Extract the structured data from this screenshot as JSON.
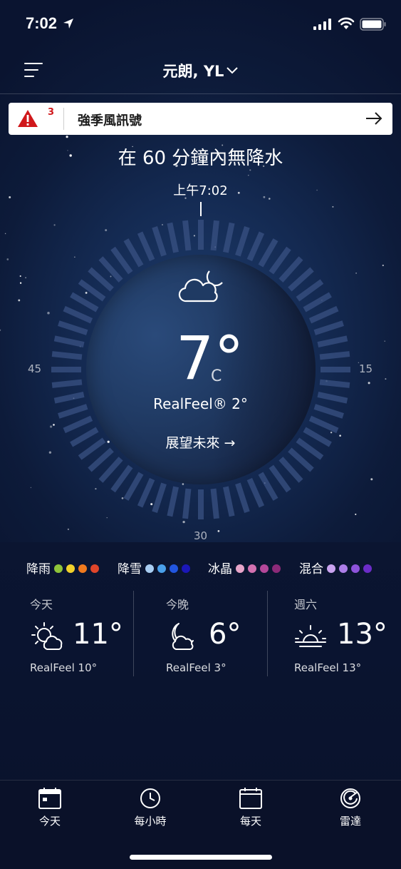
{
  "status_bar": {
    "time": "7:02"
  },
  "header": {
    "location": "元朗, YL"
  },
  "alert": {
    "count": "3",
    "text": "強季風訊號"
  },
  "minutecast": {
    "summary": "在 60 分鐘內無降水",
    "time": "上午7:02"
  },
  "dial": {
    "label_right": "15",
    "label_bottom": "30",
    "label_left": "45"
  },
  "current": {
    "condition_icon": "moon-cloud-icon",
    "temperature": "7°",
    "unit": "C",
    "realfeel": "RealFeel® 2°",
    "outlook": "展望未來 →"
  },
  "legend": [
    {
      "label": "降雨",
      "colors": [
        "#8fc43a",
        "#f2d12b",
        "#f07a1e",
        "#e0452a"
      ]
    },
    {
      "label": "降雪",
      "colors": [
        "#a9cdf2",
        "#4aa0ea",
        "#2256e0",
        "#1b17b8"
      ]
    },
    {
      "label": "冰晶",
      "colors": [
        "#e7a5c9",
        "#d371b0",
        "#b4479a",
        "#8c2a78"
      ]
    },
    {
      "label": "混合",
      "colors": [
        "#c9a3ef",
        "#ad7ee8",
        "#8e53db",
        "#6b2cc8"
      ]
    }
  ],
  "forecast": [
    {
      "title": "今天",
      "icon": "sun-cloud-icon",
      "temp": "11°",
      "realfeel": "RealFeel 10°"
    },
    {
      "title": "今晚",
      "icon": "moon-cloud-icon",
      "temp": "6°",
      "realfeel": "RealFeel 3°"
    },
    {
      "title": "週六",
      "icon": "sunrise-icon",
      "temp": "13°",
      "realfeel": "RealFeel 13°"
    }
  ],
  "tabs": [
    {
      "label": "今天",
      "icon": "calendar-day-icon"
    },
    {
      "label": "每小時",
      "icon": "clock-icon"
    },
    {
      "label": "每天",
      "icon": "calendar-icon"
    },
    {
      "label": "雷達",
      "icon": "radar-icon"
    }
  ]
}
